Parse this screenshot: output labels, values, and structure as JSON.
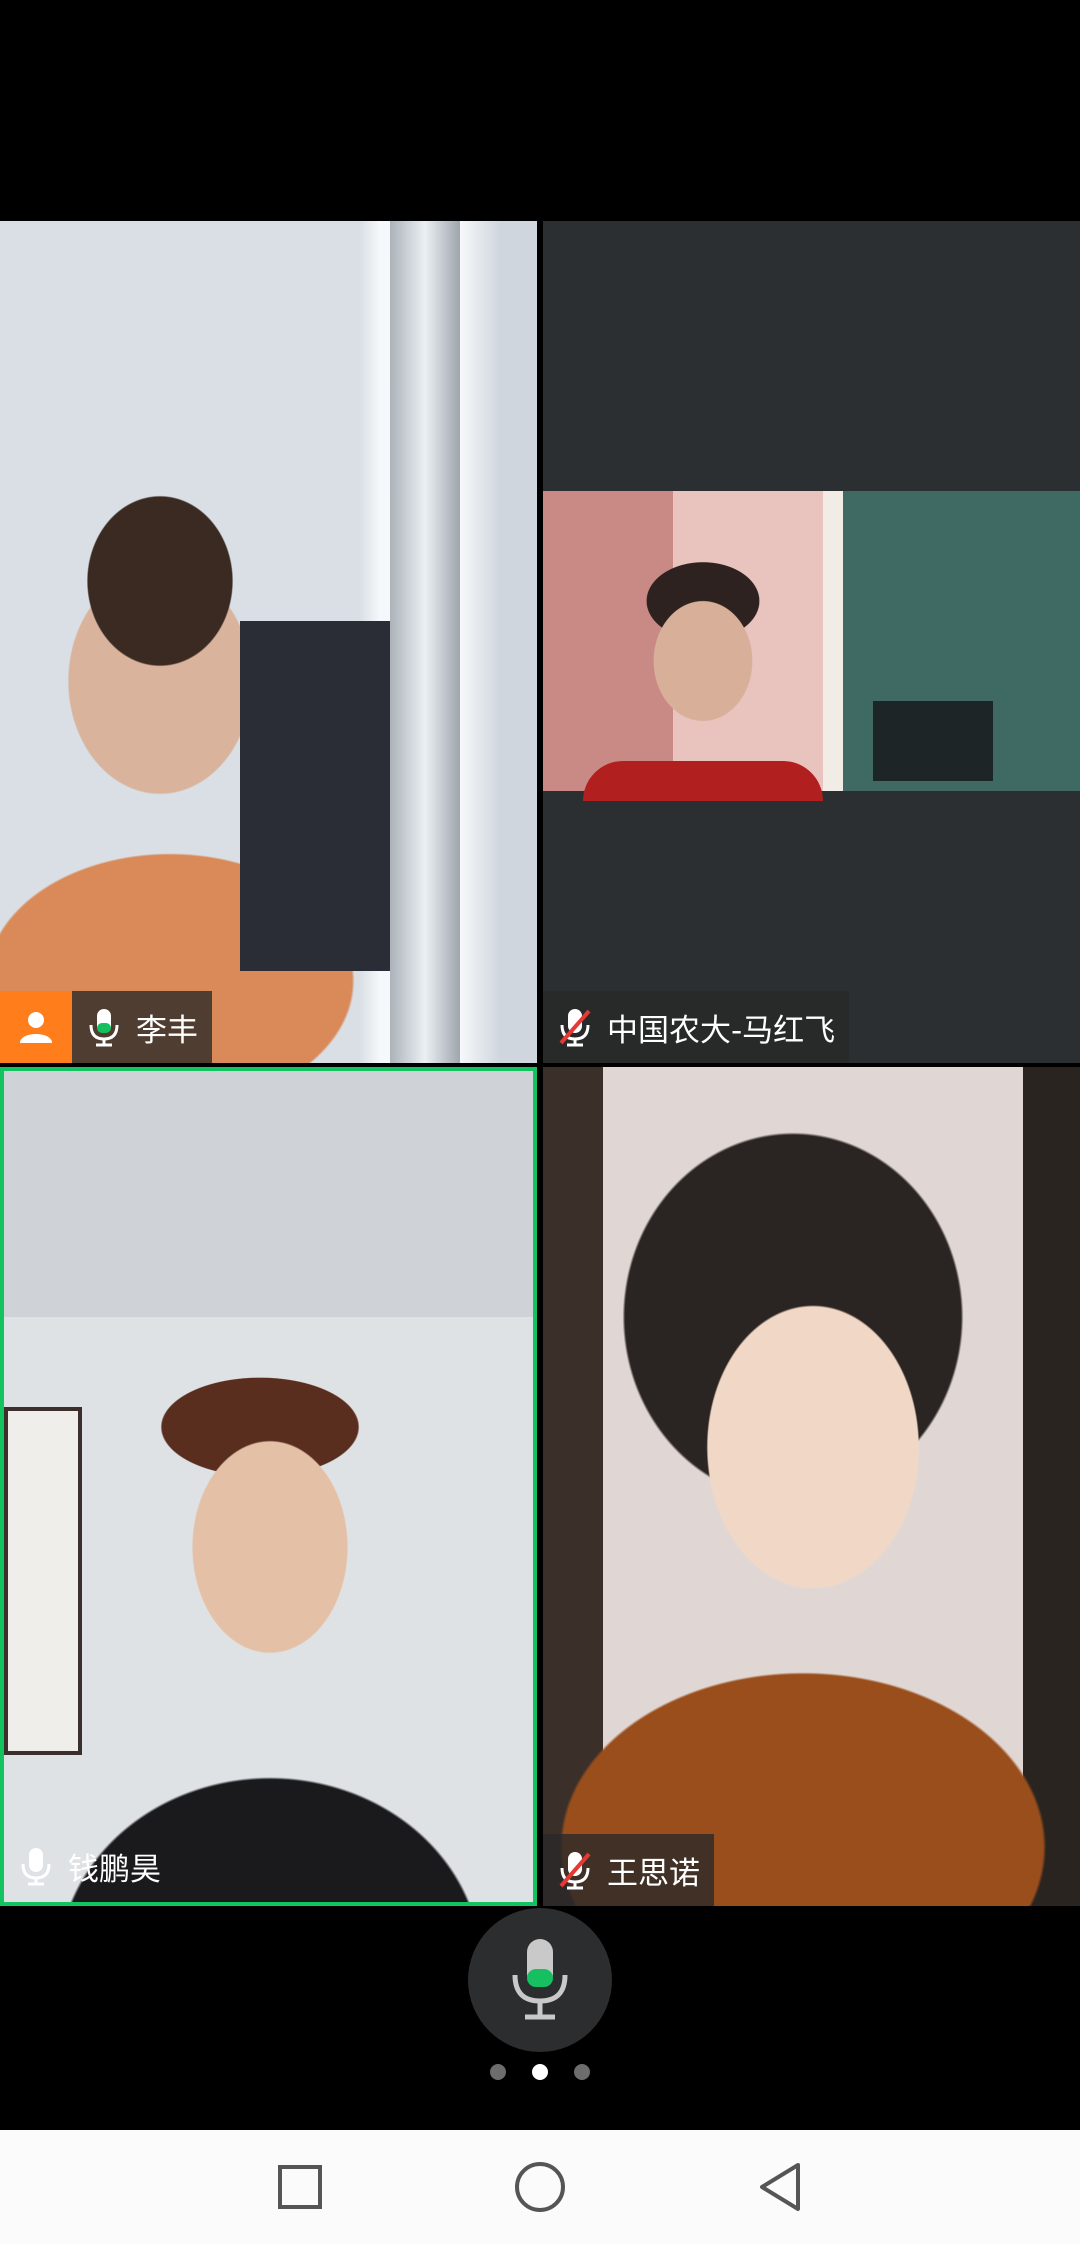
{
  "participants": [
    {
      "name": "李丰",
      "role": "host",
      "mic": "on",
      "active_speaker": false
    },
    {
      "name": "中国农大-马红飞",
      "mic": "muted",
      "active_speaker": false
    },
    {
      "name": "钱鹏昊",
      "mic": "on",
      "active_speaker": true
    },
    {
      "name": "王思诺",
      "mic": "muted",
      "active_speaker": false
    }
  ],
  "controls": {
    "microphone": "mic-icon",
    "page_dots": 3,
    "current_page": 2
  },
  "colors": {
    "host_badge": "#ff7d1a",
    "active_speaker_border": "#12c35f",
    "mic_on": "#16c060",
    "mic_muted": "#e53935"
  },
  "navigation": [
    "recent-apps",
    "home",
    "back"
  ]
}
